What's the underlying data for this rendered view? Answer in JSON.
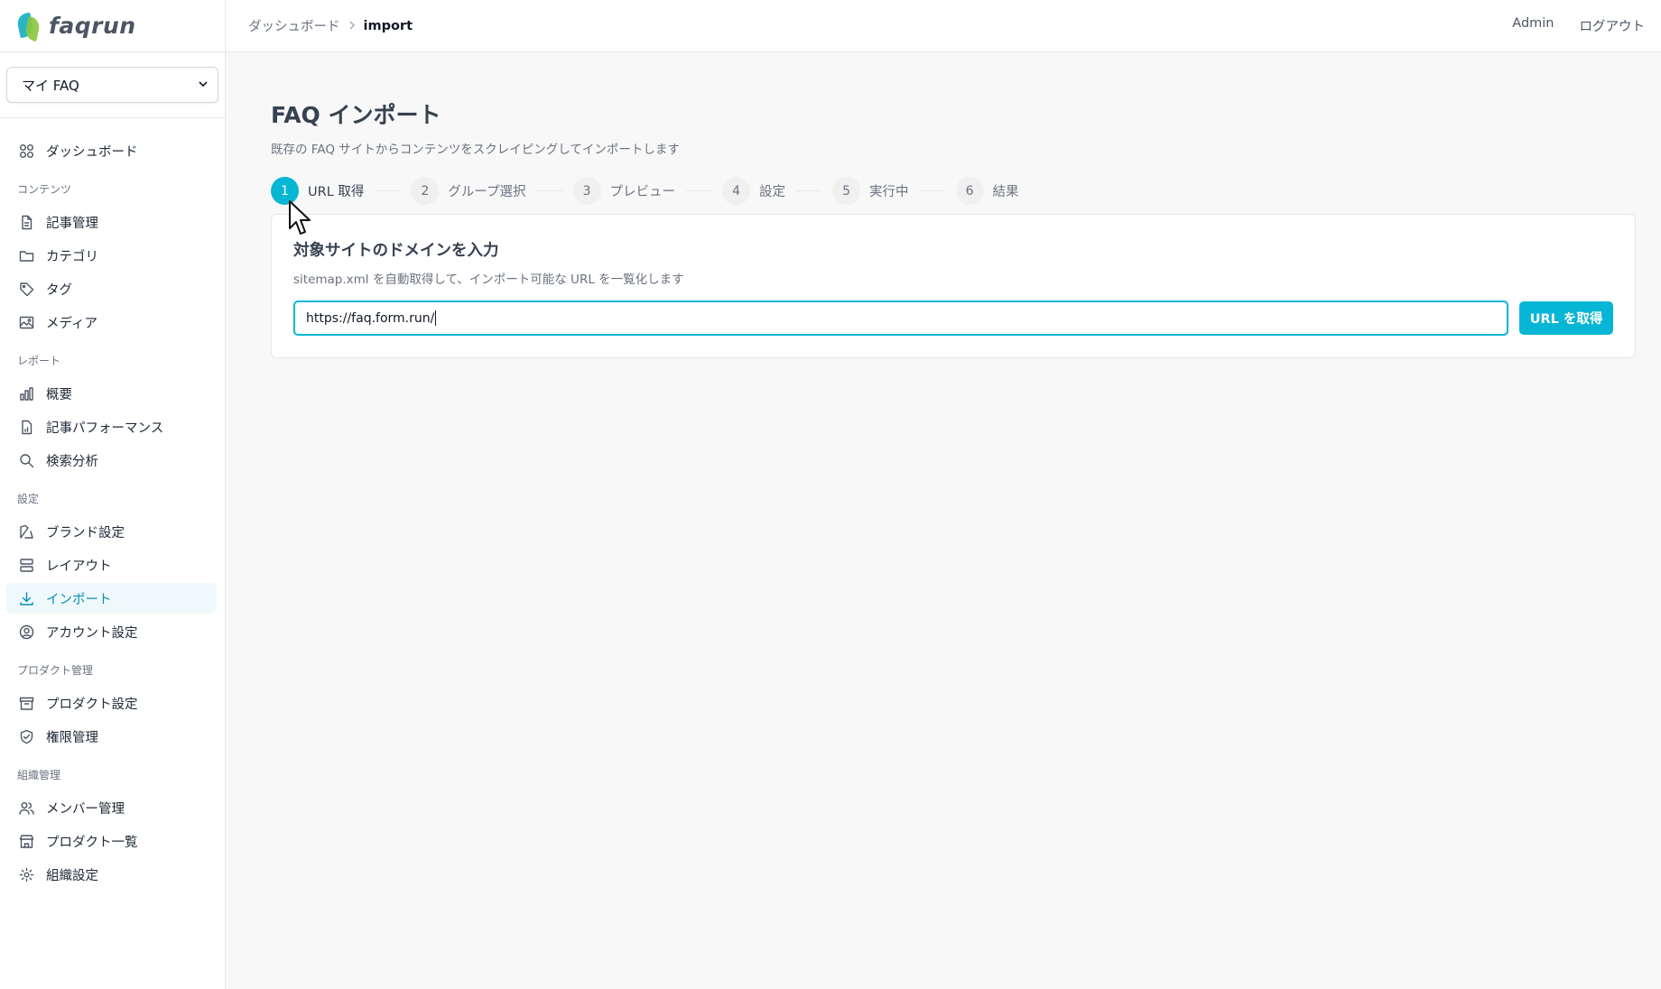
{
  "app": {
    "logo_text": "faqrun"
  },
  "faq_selector": {
    "value": "マイ FAQ"
  },
  "sidebar": {
    "dashboard": {
      "label": "ダッシュボード",
      "icon": "grid-icon"
    },
    "sections": [
      {
        "title": "コンテンツ",
        "items": [
          {
            "label": "記事管理",
            "icon": "document-icon"
          },
          {
            "label": "カテゴリ",
            "icon": "folder-icon"
          },
          {
            "label": "タグ",
            "icon": "tag-icon"
          },
          {
            "label": "メディア",
            "icon": "image-icon"
          }
        ]
      },
      {
        "title": "レポート",
        "items": [
          {
            "label": "概要",
            "icon": "bar-chart-icon"
          },
          {
            "label": "記事パフォーマンス",
            "icon": "doc-chart-icon"
          },
          {
            "label": "検索分析",
            "icon": "search-icon"
          }
        ]
      },
      {
        "title": "設定",
        "items": [
          {
            "label": "ブランド設定",
            "icon": "palette-icon"
          },
          {
            "label": "レイアウト",
            "icon": "layout-icon"
          },
          {
            "label": "インポート",
            "icon": "download-icon",
            "active": true
          },
          {
            "label": "アカウント設定",
            "icon": "user-circle-icon"
          }
        ]
      },
      {
        "title": "プロダクト管理",
        "items": [
          {
            "label": "プロダクト設定",
            "icon": "archive-icon"
          },
          {
            "label": "権限管理",
            "icon": "shield-check-icon"
          }
        ]
      },
      {
        "title": "組織管理",
        "items": [
          {
            "label": "メンバー管理",
            "icon": "users-icon"
          },
          {
            "label": "プロダクト一覧",
            "icon": "store-icon"
          },
          {
            "label": "組織設定",
            "icon": "gear-icon"
          }
        ]
      }
    ]
  },
  "topbar": {
    "breadcrumb": [
      "ダッシュボード",
      "import"
    ],
    "user": "Admin",
    "logout": "ログアウト"
  },
  "page": {
    "title": "FAQ インポート",
    "subtitle": "既存の FAQ サイトからコンテンツをスクレイピングしてインポートします"
  },
  "steps": [
    {
      "num": "1",
      "label": "URL 取得",
      "active": true
    },
    {
      "num": "2",
      "label": "グループ選択"
    },
    {
      "num": "3",
      "label": "プレビュー"
    },
    {
      "num": "4",
      "label": "設定"
    },
    {
      "num": "5",
      "label": "実行中"
    },
    {
      "num": "6",
      "label": "結果"
    }
  ],
  "card": {
    "title": "対象サイトのドメインを入力",
    "subtitle": "sitemap.xml を自動取得して、インポート可能な URL を一覧化します",
    "url_value": "https://faq.form.run/",
    "button": "URL を取得"
  },
  "colors": {
    "accent": "#06b6d4",
    "active_bg": "#eff8fb"
  }
}
